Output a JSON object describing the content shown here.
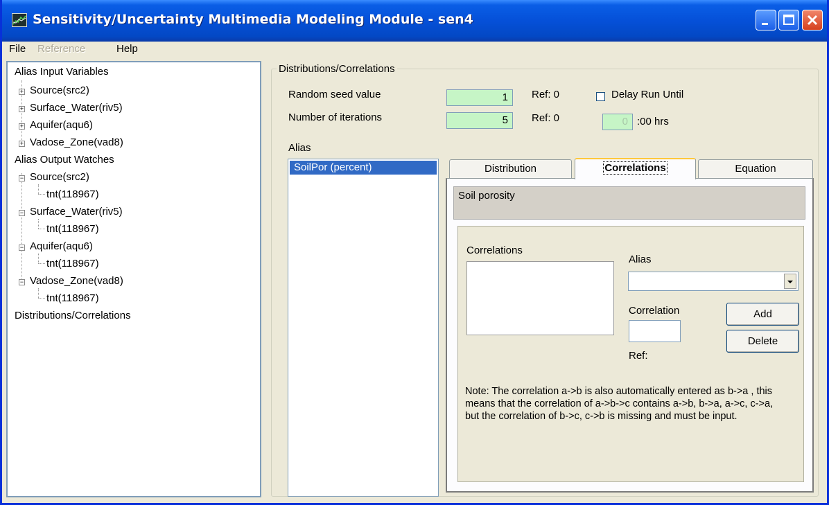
{
  "window": {
    "title": "Sensitivity/Uncertainty Multimedia Modeling Module - sen4",
    "title_bar_color": "#0550d8"
  },
  "menu": {
    "file": "File",
    "reference": "Reference",
    "help": "Help"
  },
  "tree": {
    "inputs_header": "Alias Input Variables",
    "inputs": [
      "Source(src2)",
      "Surface_Water(riv5)",
      "Aquifer(aqu6)",
      "Vadose_Zone(vad8)"
    ],
    "outputs_header": "Alias Output Watches",
    "outputs": [
      {
        "label": "Source(src2)",
        "child": "tnt(118967)"
      },
      {
        "label": "Surface_Water(riv5)",
        "child": "tnt(118967)"
      },
      {
        "label": "Aquifer(aqu6)",
        "child": "tnt(118967)"
      },
      {
        "label": "Vadose_Zone(vad8)",
        "child": "tnt(118967)"
      }
    ],
    "distributions": "Distributions/Correlations"
  },
  "panel": {
    "group_title": "Distributions/Correlations",
    "seed_label": "Random seed value",
    "seed_value": "1",
    "seed_ref": "Ref: 0",
    "iter_label": "Number of iterations",
    "iter_value": "5",
    "iter_ref": "Ref: 0",
    "delay_label": "Delay Run Until",
    "delay_value": "0",
    "delay_suffix": ":00 hrs",
    "alias_label": "Alias",
    "alias_items": [
      "SoilPor (percent)"
    ],
    "field_color": "#c6f5c6"
  },
  "tabs": [
    "Distribution",
    "Correlations",
    "Equation"
  ],
  "correlations": {
    "description": "Soil porosity",
    "list_label": "Correlations",
    "alias_label": "Alias",
    "alias_value": "",
    "correlation_label": "Correlation",
    "ref_label": "Ref:",
    "add_button": "Add",
    "delete_button": "Delete",
    "note": "Note: The correlation a->b is also automatically entered as b->a , this means that the correlation of a->b->c contains a->b, b->a, a->c, c->a, but the correlation of  b->c, c->b is missing and must be input."
  }
}
